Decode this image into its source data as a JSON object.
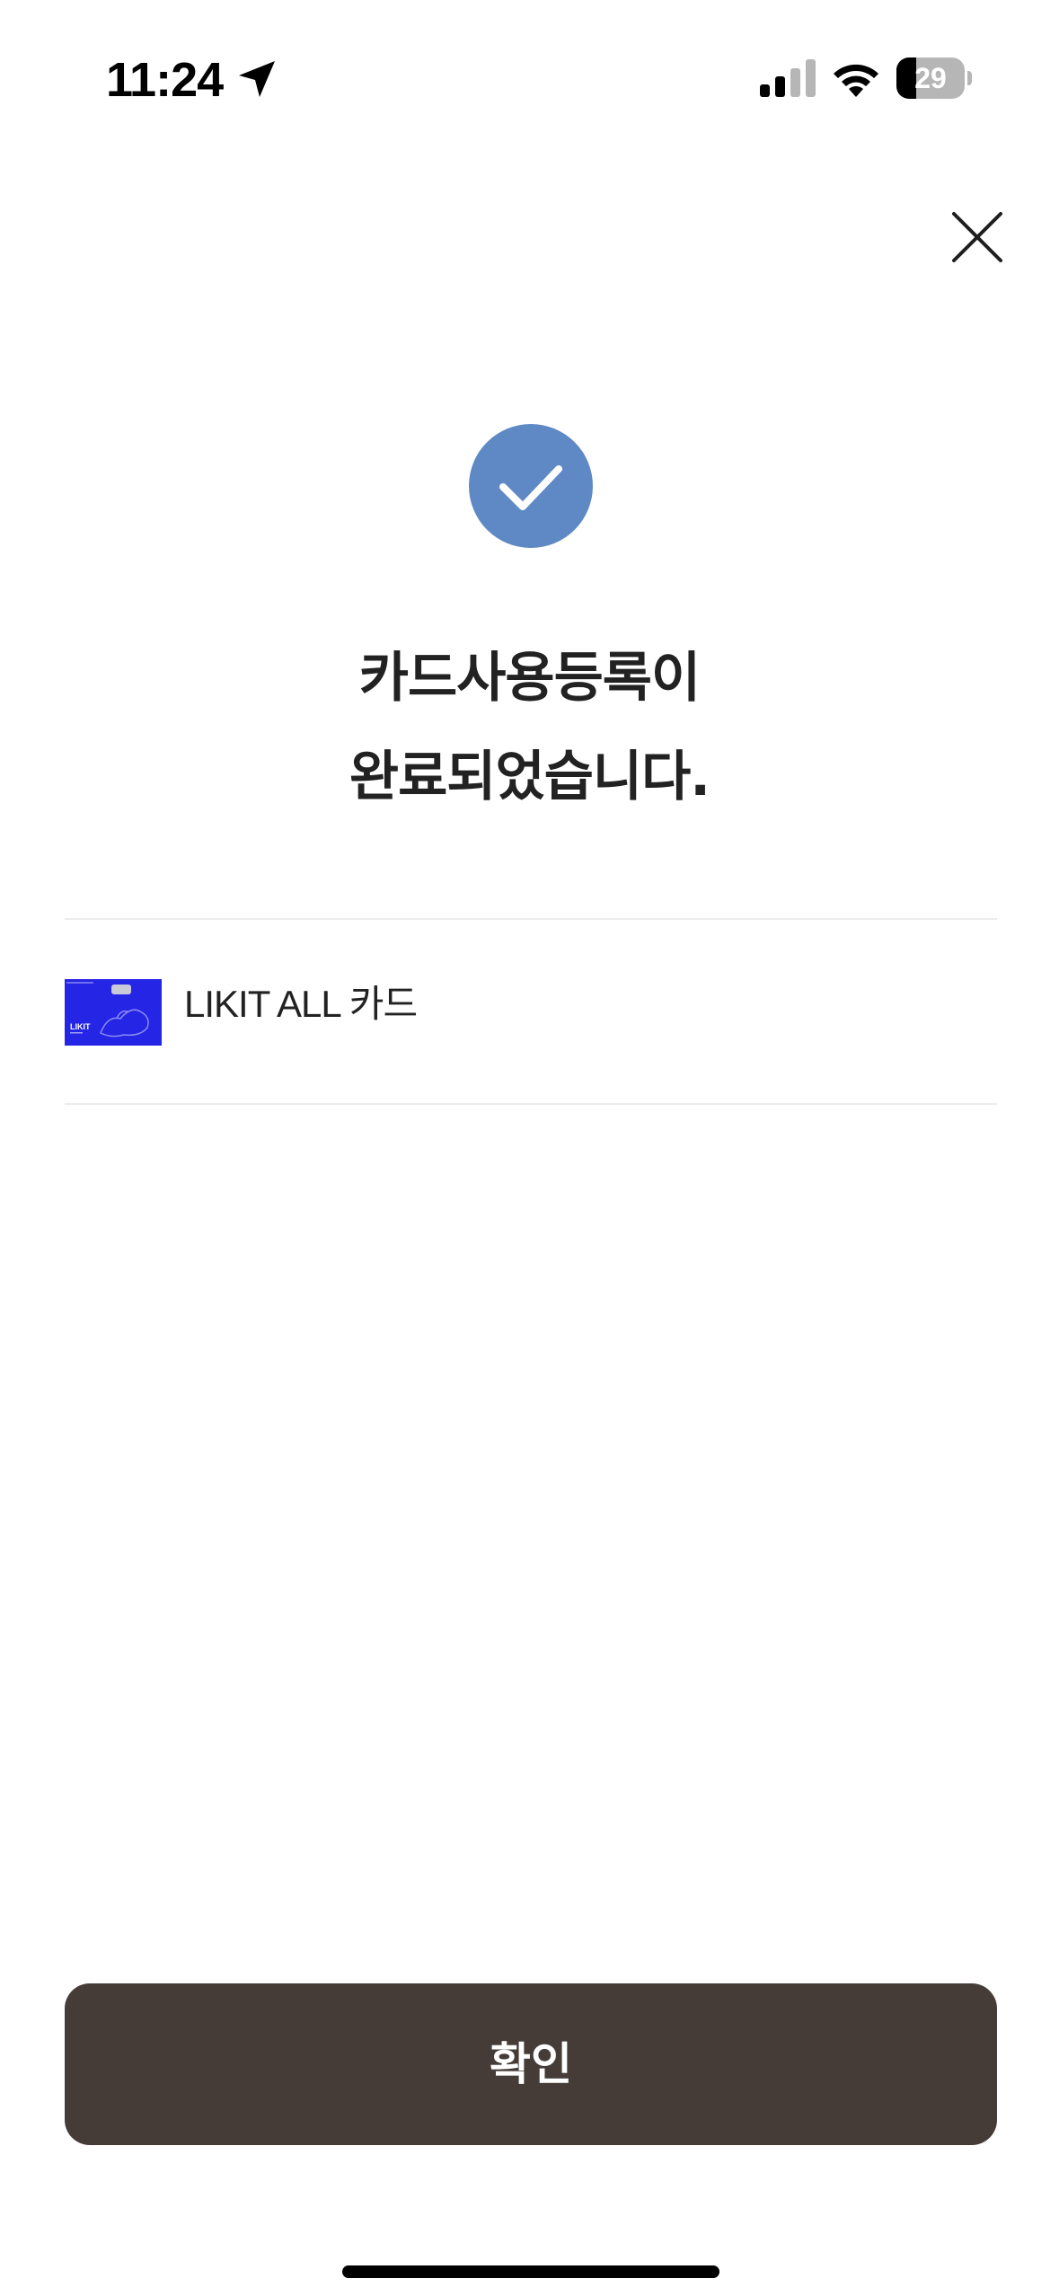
{
  "status_bar": {
    "time": "11:24",
    "battery_level": "29",
    "battery_fraction": 0.29,
    "signal_bars_active": 2,
    "signal_bars_total": 4,
    "icons": [
      "location-arrow-icon",
      "cellular-signal-icon",
      "wifi-icon",
      "battery-icon"
    ]
  },
  "header": {
    "close_icon": "close-icon"
  },
  "success": {
    "icon": "check-circle-icon",
    "icon_color": "#5e89c5",
    "title_line1": "카드사용등록이",
    "title_line2": "완료되었습니다."
  },
  "card": {
    "name": "LIKIT ALL 카드",
    "thumbnail_color": "#2525e6",
    "thumbnail_text": "LIKIT"
  },
  "footer": {
    "confirm_label": "확인",
    "confirm_color": "#453c38"
  }
}
